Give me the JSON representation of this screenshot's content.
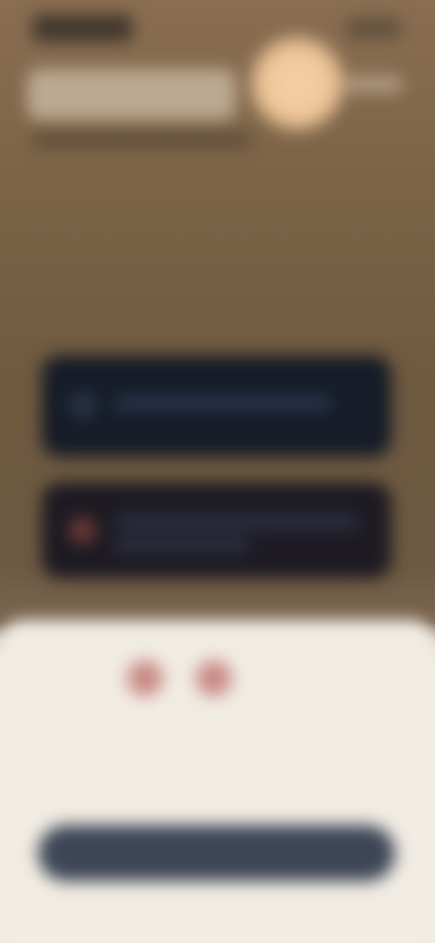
{
  "status_bar": {
    "time": "",
    "indicators": ""
  },
  "header": {
    "title": "",
    "subtitle": "",
    "tag": ""
  },
  "cards": [
    {
      "label": ""
    },
    {
      "label": "",
      "sublabel": ""
    }
  ],
  "sheet": {
    "line_1": "",
    "line_2": "",
    "button_label": ""
  },
  "colors": {
    "background_top": "#8a6e52",
    "card_dark": "#161c28",
    "sheet_bg": "#f1ece3",
    "accent_dots": "#c98a86",
    "button_bg": "#3d4656",
    "orb": "#f6d2a6"
  }
}
